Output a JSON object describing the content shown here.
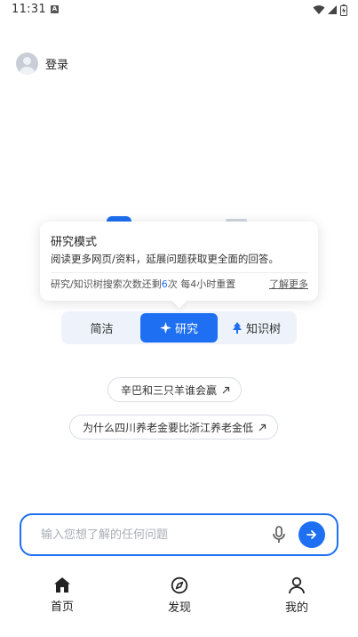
{
  "status_bar": {
    "time": "11:31",
    "notification_badge": "A",
    "icons": [
      "wifi-icon",
      "signal-icon",
      "battery-icon"
    ]
  },
  "login": {
    "label": "登录",
    "icon": "avatar-icon"
  },
  "popover": {
    "title": "研究模式",
    "description": "阅读更多网页/资料，延展问题获取更全面的回答。",
    "footer_prefix": "研究/知识树搜索次数还剩",
    "footer_count": "6",
    "footer_suffix": "次 每4小时重置",
    "link": "了解更多"
  },
  "modes": {
    "selected": "研究",
    "items": [
      {
        "label": "简洁",
        "icon": ""
      },
      {
        "label": "研究",
        "icon": "sparkle-icon"
      },
      {
        "label": "知识树",
        "icon": "tree-icon"
      }
    ]
  },
  "suggestions": [
    {
      "label": "辛巴和三只羊谁会赢",
      "icon": "arrow-up-right-icon"
    },
    {
      "label": "为什么四川养老金要比浙江养老金低",
      "icon": "arrow-up-right-icon"
    }
  ],
  "search": {
    "placeholder": "输入您想了解的任何问题",
    "value": ""
  },
  "bottom_nav": [
    {
      "label": "首页",
      "icon": "home-icon",
      "active": true
    },
    {
      "label": "发现",
      "icon": "compass-icon",
      "active": false
    },
    {
      "label": "我的",
      "icon": "user-icon",
      "active": false
    }
  ],
  "colors": {
    "accent": "#1e6ff1",
    "mode_bar_bg": "#eef3fb",
    "text": "#222222"
  }
}
